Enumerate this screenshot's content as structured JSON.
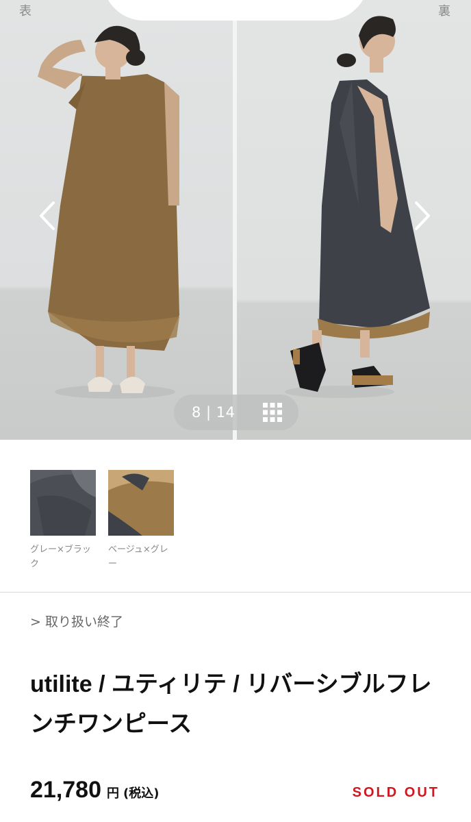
{
  "gallery": {
    "left_corner_label": "表",
    "right_corner_label": "裏",
    "counter_text": "8 | 14",
    "prev_icon": "chevron-left-icon",
    "next_icon": "chevron-right-icon",
    "grid_icon": "grid-icon"
  },
  "swatches": [
    {
      "label": "グレー×ブラック",
      "color": "#4b4e55"
    },
    {
      "label": "ベージュ×グレー",
      "color": "#9c7a4a"
    }
  ],
  "status_link": "> 取り扱い終了",
  "product": {
    "title": "utilite / ユティリテ / リバーシブルフレンチワンピース",
    "price": "21,780",
    "currency": "円",
    "tax_label": "(税込)",
    "sold_out": "SOLD OUT"
  },
  "colors": {
    "sold_out": "#d0161f",
    "dress_left": "#8a6a40",
    "dress_right": "#3f4148"
  }
}
